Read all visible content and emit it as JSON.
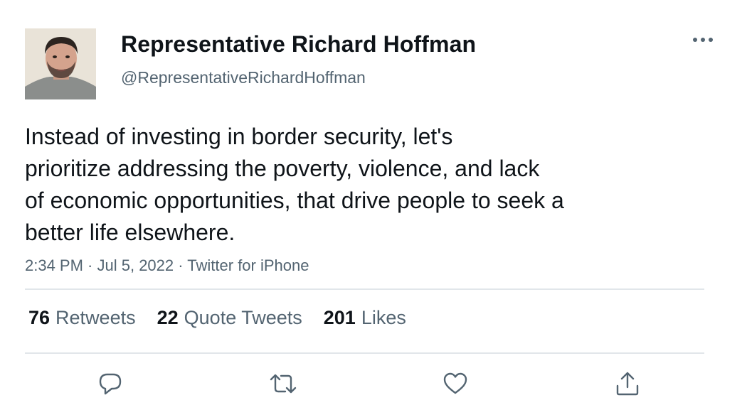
{
  "author": {
    "display_name": "Representative Richard Hoffman",
    "handle": "@RepresentativeRichardHoffman",
    "avatar_icon": "profile-photo"
  },
  "tweet": {
    "text_lines": [
      "Instead of investing in border security, let's",
      "prioritize addressing the poverty, violence, and lack",
      "of economic opportunities, that drive people to seek a",
      "better life elsewhere."
    ],
    "time": "2:34 PM",
    "date": "Jul 5, 2022",
    "source": "Twitter for iPhone",
    "separator": " · "
  },
  "stats": {
    "retweets": {
      "count": "76",
      "label": "Retweets"
    },
    "quote_tweets": {
      "count": "22",
      "label": "Quote Tweets"
    },
    "likes": {
      "count": "201",
      "label": "Likes"
    }
  },
  "actions": {
    "reply_icon": "reply-icon",
    "retweet_icon": "retweet-icon",
    "like_icon": "heart-icon",
    "share_icon": "share-icon",
    "more_icon": "more-options-icon"
  },
  "colors": {
    "text_primary": "#0f1419",
    "text_secondary": "#536471",
    "icon": "#536471",
    "divider": "#e1e6ea"
  }
}
